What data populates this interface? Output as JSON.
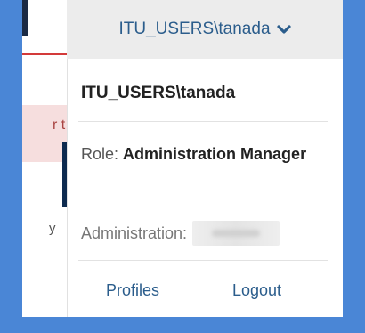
{
  "header": {
    "user_toggle_label": "ITU_USERS\\tanada",
    "toggle_icon": "chevron-down-icon"
  },
  "dropdown": {
    "username": "ITU_USERS\\tanada",
    "role_label": "Role:",
    "role_value": "Administration Manager",
    "administration_label": "Administration:",
    "links": {
      "profiles": "Profiles",
      "logout": "Logout"
    }
  },
  "colors": {
    "frame": "#4a86d6",
    "link": "#2b5d8c",
    "toggle_bg": "#ececec",
    "alert_bg": "#f6dede",
    "dark_bar": "#0d2a4f"
  }
}
